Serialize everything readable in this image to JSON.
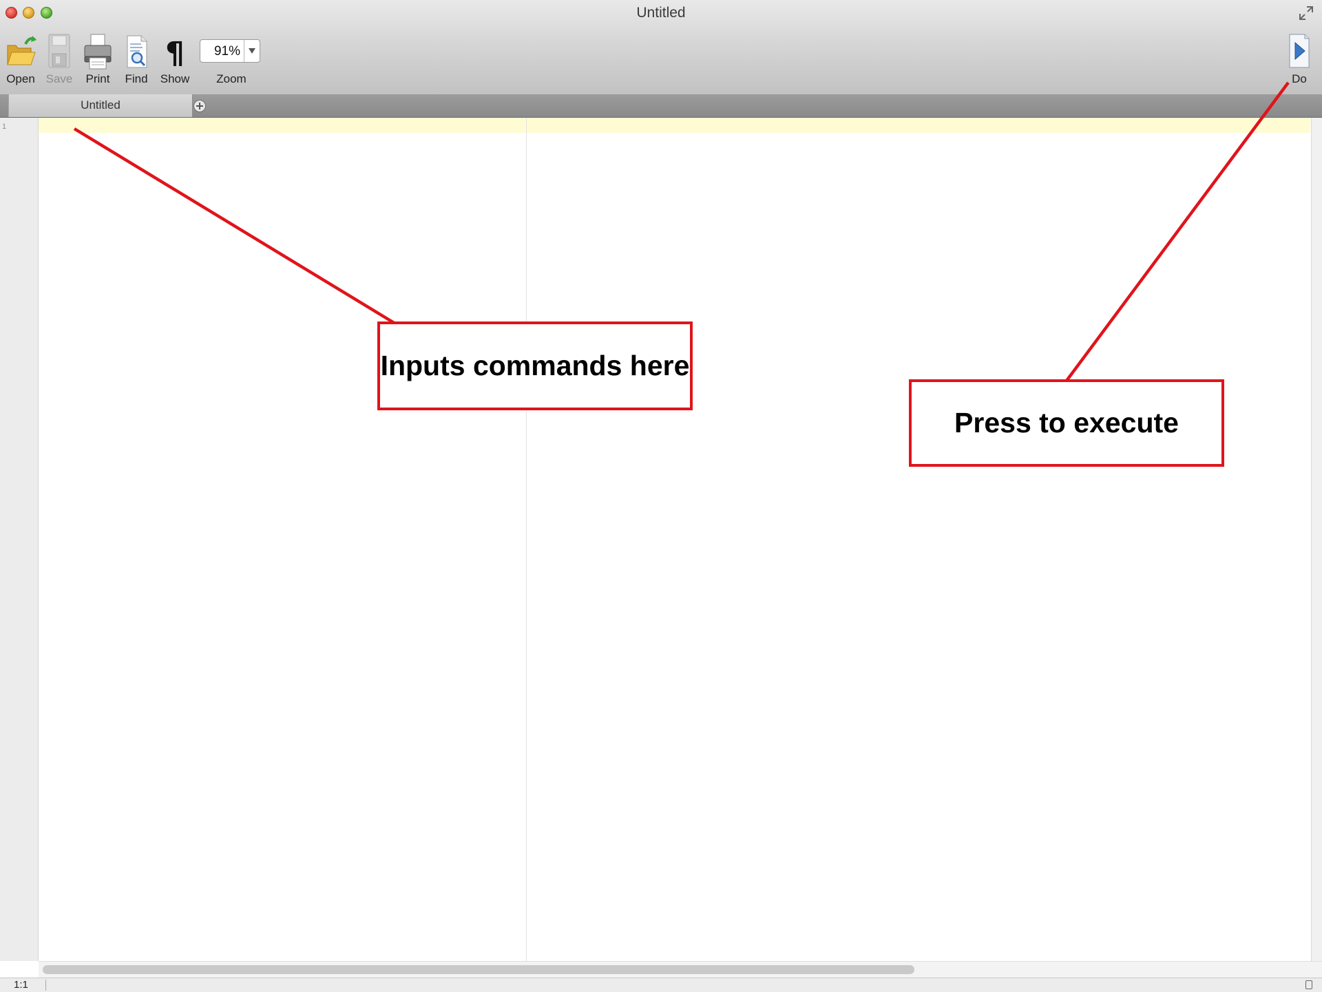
{
  "window": {
    "title": "Untitled"
  },
  "toolbar": {
    "open_label": "Open",
    "save_label": "Save",
    "print_label": "Print",
    "find_label": "Find",
    "show_label": "Show",
    "zoom_value": "91%",
    "zoom_label": "Zoom",
    "do_label": "Do"
  },
  "tabs": [
    {
      "label": "Untitled"
    }
  ],
  "editor": {
    "line_numbers": [
      "1"
    ],
    "text": ""
  },
  "status": {
    "position": "1:1"
  },
  "annotations": {
    "input_callout": "Inputs commands here",
    "execute_callout": "Press to execute",
    "color": "#e0141b"
  },
  "colors": {
    "current_line": "#fffcd3",
    "close": "#d8352b",
    "minimize": "#d99a1e",
    "zoom": "#4fa72a"
  },
  "icons": [
    "folder-open-icon",
    "floppy-disk-icon",
    "printer-icon",
    "magnifier-document-icon",
    "pilcrow-icon",
    "play-document-icon",
    "fullscreen-icon",
    "add-tab-icon"
  ]
}
